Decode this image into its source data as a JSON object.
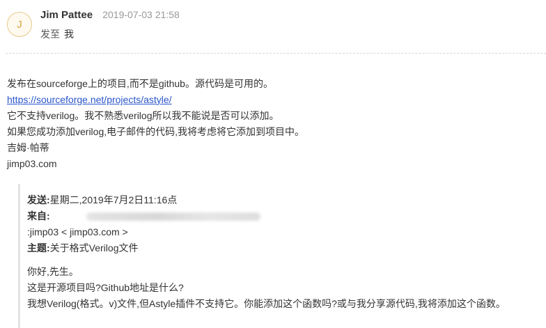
{
  "sender": {
    "avatar_letter": "J",
    "name": "Jim Pattee",
    "time": "2019-07-03 21:58",
    "to_label": "发至",
    "to_value": "我"
  },
  "body": {
    "line1": "发布在sourceforge上的项目,而不是github。源代码是可用的。",
    "link": "https://sourceforge.net/projects/astyle/",
    "line3": "它不支持verilog。我不熟悉verilog所以我不能说是否可以添加。",
    "line4": "如果您成功添加verilog,电子邮件的代码,我将考虑将它添加到项目中。",
    "signature_name": "吉姆·帕蒂",
    "signature_site": "jimp03.com"
  },
  "quote": {
    "sent_label": "发送:",
    "sent_value": "星期二,2019年7月2日11:16点",
    "from_label": "来自:",
    "to_line": ":jimp03 < jimp03.com >",
    "subject_label": "主题:",
    "subject_value": "关于格式Verilog文件",
    "message": [
      "你好,先生。",
      "这是开源项目吗?Github地址是什么?",
      "我想Verilog(格式。v)文件,但Astyle插件不支持它。你能添加这个函数吗?或与我分享源代码,我将添加这个函数。"
    ]
  }
}
